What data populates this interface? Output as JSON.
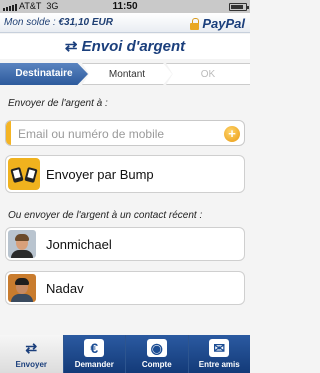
{
  "status_bar": {
    "carrier": "AT&T",
    "network": "3G",
    "time": "11:50"
  },
  "header": {
    "balance_label": "Mon solde :",
    "balance_value": "€31,10 EUR",
    "brand": "PayPal",
    "title": "Envoi d'argent"
  },
  "tabs": [
    {
      "label": "Destinataire",
      "state": "active"
    },
    {
      "label": "Montant",
      "state": "inactive"
    },
    {
      "label": "OK",
      "state": "disabled"
    }
  ],
  "send_section": {
    "label": "Envoyer de l'argent à :",
    "input_value": "",
    "input_placeholder": "Email ou numéro de mobile",
    "bump_label": "Envoyer par Bump"
  },
  "recent_section": {
    "label": "Ou envoyer de l'argent à un contact récent :",
    "contacts": [
      {
        "name": "Jonmichael"
      },
      {
        "name": "Nadav"
      }
    ]
  },
  "tab_bar": [
    {
      "label": "Envoyer",
      "icon": "send-arrows-icon",
      "active": true
    },
    {
      "label": "Demander",
      "icon": "euro-request-icon",
      "active": false
    },
    {
      "label": "Compte",
      "icon": "account-person-icon",
      "active": false
    },
    {
      "label": "Entre amis",
      "icon": "friends-icon",
      "active": false
    }
  ],
  "colors": {
    "brand_blue": "#1b3f7c",
    "accent_orange": "#f4b424",
    "tab_active": "#2d5a9c"
  }
}
